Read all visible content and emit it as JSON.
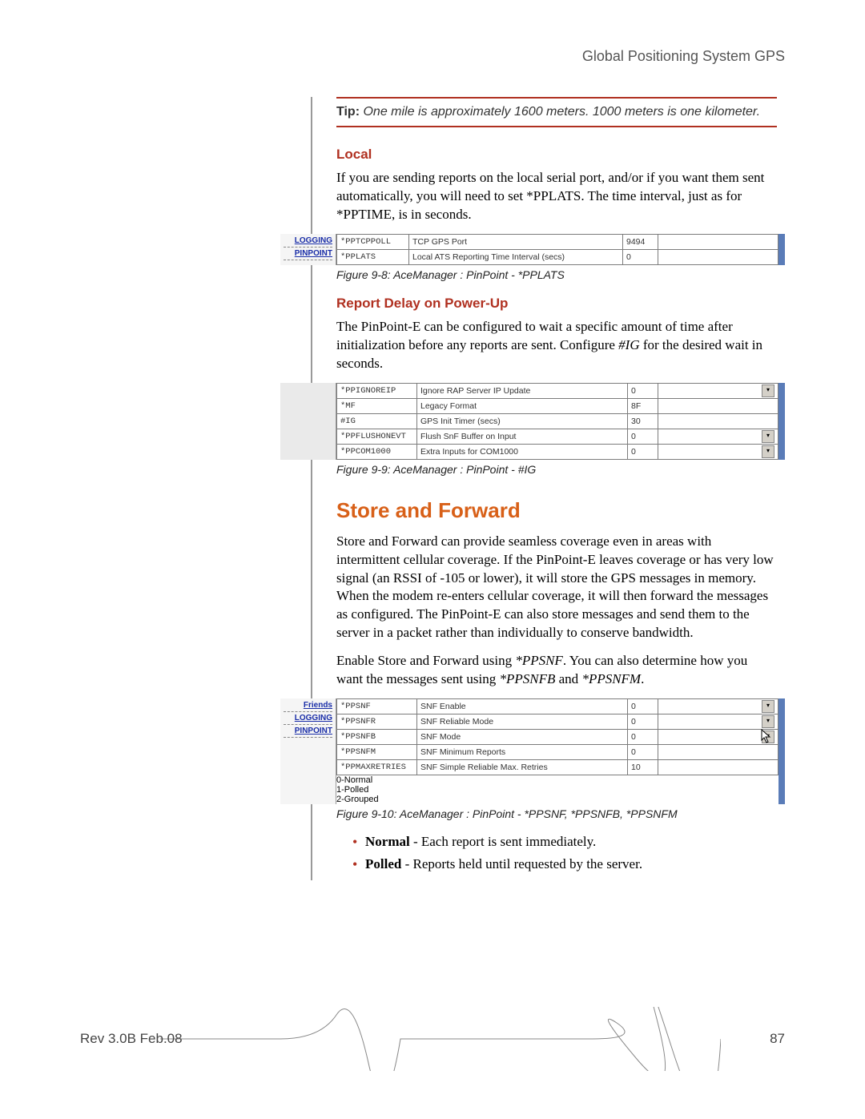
{
  "header": {
    "title": "Global Positioning System GPS"
  },
  "tip": {
    "label": "Tip:",
    "text": "One mile is approximately 1600 meters. 1000 meters is one kilometer."
  },
  "sections": {
    "local": {
      "heading": "Local",
      "para": "If you are sending reports on the local serial port, and/or if you want them sent automatically, you will need to set *PPLATS. The time interval, just as for *PPTIME, is in seconds."
    },
    "delay": {
      "heading": "Report Delay on Power-Up",
      "para": "The PinPoint-E can be configured to wait a specific amount of time after initialization before any reports are sent. Configure #IG for the desired wait in seconds."
    },
    "store": {
      "heading": "Store and Forward",
      "p1": "Store and Forward can provide seamless coverage even in areas with intermittent cellular coverage. If the PinPoint-E leaves coverage or has very low signal (an RSSI of -105 or lower), it will store the GPS messages in memory. When the modem re-enters cellular coverage, it will then forward the messages as configured. The PinPoint-E can also store messages and send them to the server in a packet rather than individually to conserve bandwidth.",
      "p2a": "Enable Store and Forward using ",
      "p2b": "*PPSNF",
      "p2c": ". You can also determine how you want the messages sent using ",
      "p2d": "*PPSNFB",
      "p2e": " and ",
      "p2f": "*PPSNFM",
      "p2g": "."
    }
  },
  "fig8": {
    "caption": "Figure 9-8: AceManager : PinPoint - *PPLATS",
    "side": {
      "logging": "LOGGING",
      "pinpoint": "PINPOINT"
    },
    "rows": [
      {
        "cmd": "*PPTCPPOLL",
        "desc": "TCP GPS Port",
        "val": "9494"
      },
      {
        "cmd": "*PPLATS",
        "desc": "Local ATS Reporting Time Interval (secs)",
        "val": "0"
      }
    ]
  },
  "fig9": {
    "caption": "Figure 9-9: AceManager : PinPoint - #IG",
    "rows": [
      {
        "cmd": "*PPIGNOREIP",
        "desc": "Ignore RAP Server IP Update",
        "val": "0",
        "dd": true
      },
      {
        "cmd": "*MF",
        "desc": "Legacy Format",
        "val": "8F",
        "dd": false
      },
      {
        "cmd": "#IG",
        "desc": "GPS Init Timer (secs)",
        "val": "30",
        "dd": false
      },
      {
        "cmd": "*PPFLUSHONEVT",
        "desc": "Flush SnF Buffer on Input",
        "val": "0",
        "dd": true
      },
      {
        "cmd": "*PPCOM1000",
        "desc": "Extra Inputs for COM1000",
        "val": "0",
        "dd": true
      }
    ]
  },
  "fig10": {
    "caption": "Figure 9-10: AceManager : PinPoint - *PPSNF, *PPSNFB, *PPSNFM",
    "side": {
      "friends": "Friends",
      "logging": "LOGGING",
      "pinpoint": "PINPOINT"
    },
    "rows": [
      {
        "cmd": "*PPSNF",
        "desc": "SNF Enable",
        "val": "0",
        "dd": true
      },
      {
        "cmd": "*PPSNFR",
        "desc": "SNF Reliable Mode",
        "val": "0",
        "dd": true
      },
      {
        "cmd": "*PPSNFB",
        "desc": "SNF Mode",
        "val": "0",
        "dd": true,
        "tooltip": "0-Normal\n1-Polled\n2-Grouped"
      },
      {
        "cmd": "*PPSNFM",
        "desc": "SNF Minimum Reports",
        "val": "0",
        "dd": false
      },
      {
        "cmd": "*PPMAXRETRIES",
        "desc": "SNF Simple Reliable Max. Retries",
        "val": "10",
        "dd": false
      }
    ],
    "tooltip_lines": [
      "0-Normal",
      "1-Polled",
      "2-Grouped"
    ]
  },
  "bullets": {
    "b1a": "Normal",
    "b1b": " - Each report is sent immediately.",
    "b2a": "Polled",
    "b2b": " - Reports held until requested by the server."
  },
  "footer": {
    "rev": "Rev 3.0B  Feb.08",
    "page": "87"
  }
}
